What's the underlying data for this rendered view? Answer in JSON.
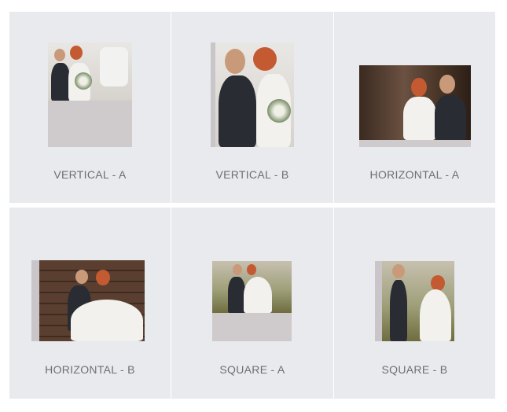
{
  "options": [
    {
      "id": "vertical-a",
      "label": "VERTICAL - A"
    },
    {
      "id": "vertical-b",
      "label": "VERTICAL - B"
    },
    {
      "id": "horizontal-a",
      "label": "HORIZONTAL - A"
    },
    {
      "id": "horizontal-b",
      "label": "HORIZONTAL - B"
    },
    {
      "id": "square-a",
      "label": "SQUARE - A"
    },
    {
      "id": "square-b",
      "label": "SQUARE - B"
    }
  ],
  "colors": {
    "card_bg": "#e8eaed",
    "label": "#6b6f74",
    "pad": "#cfcacc"
  }
}
